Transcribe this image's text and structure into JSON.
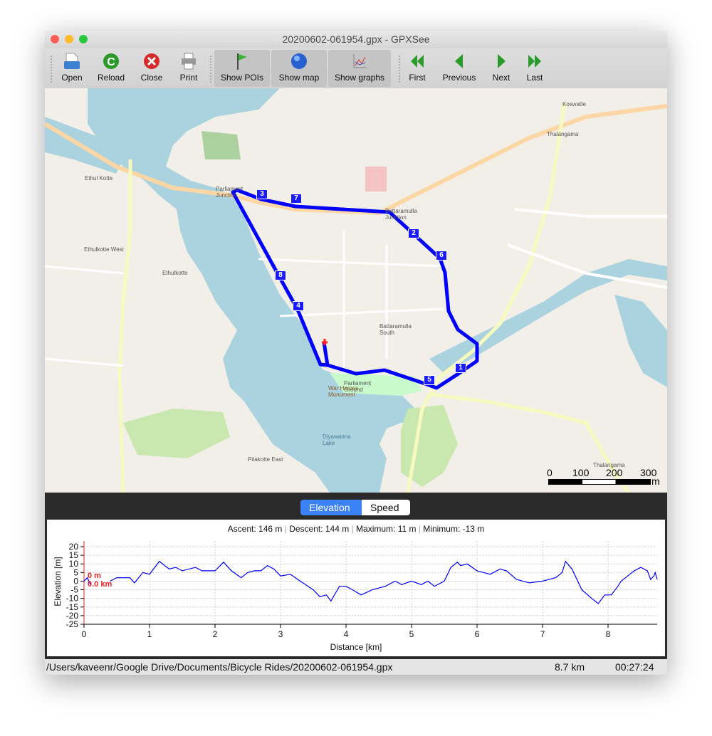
{
  "window": {
    "title": "20200602-061954.gpx - GPXSee"
  },
  "toolbar": {
    "items": [
      {
        "label": "Open",
        "icon": "open-file-icon"
      },
      {
        "label": "Reload",
        "icon": "reload-icon"
      },
      {
        "label": "Close",
        "icon": "close-icon"
      },
      {
        "label": "Print",
        "icon": "print-icon"
      },
      {
        "label": "Show POIs",
        "icon": "flag-icon",
        "active": true
      },
      {
        "label": "Show map",
        "icon": "globe-icon",
        "active": true
      },
      {
        "label": "Show graphs",
        "icon": "graph-icon",
        "active": true
      },
      {
        "label": "First",
        "icon": "first-icon"
      },
      {
        "label": "Previous",
        "icon": "previous-icon"
      },
      {
        "label": "Next",
        "icon": "next-icon"
      },
      {
        "label": "Last",
        "icon": "last-icon"
      }
    ]
  },
  "map": {
    "labels": [
      "Ethul Kotte",
      "Ethulkotte West",
      "Ethulkotte",
      "Thalangama",
      "Koswatte",
      "Battaramulla South",
      "Parliament Ground",
      "War Heroes Monument",
      "Diyawanna Lake",
      "Pitakotte East",
      "Battaramulla Junction",
      "Parliament Junction",
      "Thalangama"
    ],
    "waypoints": [
      "1",
      "2",
      "3",
      "4",
      "5",
      "6",
      "7",
      "8"
    ],
    "scale": {
      "ticks": [
        "0",
        "100",
        "200",
        "300"
      ],
      "unit": "m"
    },
    "route_color": "#0000ff"
  },
  "graph": {
    "tabs": [
      {
        "label": "Elevation",
        "selected": true
      },
      {
        "label": "Speed",
        "selected": false
      }
    ],
    "summary": {
      "ascent": "Ascent: 146 m",
      "descent": "Descent: 144 m",
      "maximum": "Maximum: 11 m",
      "minimum": "Minimum: -13 m"
    },
    "marker": {
      "elevation": "0 m",
      "distance": "0.0 km"
    }
  },
  "chart_data": {
    "type": "line",
    "xlabel": "Distance [km]",
    "ylabel": "Elevation [m]",
    "xlim": [
      0,
      8.75
    ],
    "ylim": [
      -25,
      20
    ],
    "xticks": [
      "0",
      "1",
      "2",
      "3",
      "4",
      "5",
      "6",
      "7",
      "8"
    ],
    "yticks": [
      "20",
      "15",
      "10",
      "5",
      "0",
      "-5",
      "-10",
      "-15",
      "-20",
      "-25"
    ],
    "grid": true,
    "color": "#0000ff",
    "x": [
      0,
      0.05,
      0.1,
      0.2,
      0.4,
      0.5,
      0.7,
      0.77,
      0.9,
      1.0,
      1.15,
      1.3,
      1.4,
      1.5,
      1.7,
      1.8,
      2.0,
      2.13,
      2.25,
      2.4,
      2.5,
      2.6,
      2.7,
      2.8,
      2.9,
      3.0,
      3.15,
      3.3,
      3.5,
      3.6,
      3.7,
      3.77,
      3.9,
      4.0,
      4.1,
      4.23,
      4.4,
      4.5,
      4.6,
      4.75,
      4.85,
      5.0,
      5.15,
      5.25,
      5.35,
      5.5,
      5.6,
      5.7,
      5.75,
      5.85,
      6.0,
      6.1,
      6.2,
      6.35,
      6.45,
      6.6,
      6.8,
      7.0,
      7.2,
      7.3,
      7.35,
      7.45,
      7.6,
      7.75,
      7.85,
      7.95,
      8.05,
      8.15,
      8.2,
      8.3,
      8.4,
      8.5,
      8.6,
      8.65,
      8.7,
      8.72,
      8.75
    ],
    "y": [
      0,
      2,
      -2,
      null,
      0,
      2,
      2,
      -1,
      5,
      4,
      11.5,
      7,
      8,
      6,
      8,
      6,
      6,
      11,
      6,
      2,
      5,
      6,
      6,
      9,
      7,
      3,
      4,
      0,
      -5,
      -9,
      -8,
      -11.5,
      -3,
      -3,
      -5,
      -8,
      -5,
      -4,
      -3,
      0,
      -2,
      0,
      -2,
      0,
      -3,
      0,
      8,
      11,
      9,
      10,
      6,
      5,
      4,
      7,
      6,
      1,
      -1,
      0,
      2,
      5,
      11.5,
      7,
      -5,
      -10,
      -13,
      -8,
      -8,
      -3,
      0,
      3,
      6,
      8,
      6,
      1,
      3,
      5,
      1
    ]
  },
  "status": {
    "path": "/Users/kaveenr/Google Drive/Documents/Bicycle Rides/20200602-061954.gpx",
    "distance": "8.7 km",
    "time": "00:27:24"
  }
}
